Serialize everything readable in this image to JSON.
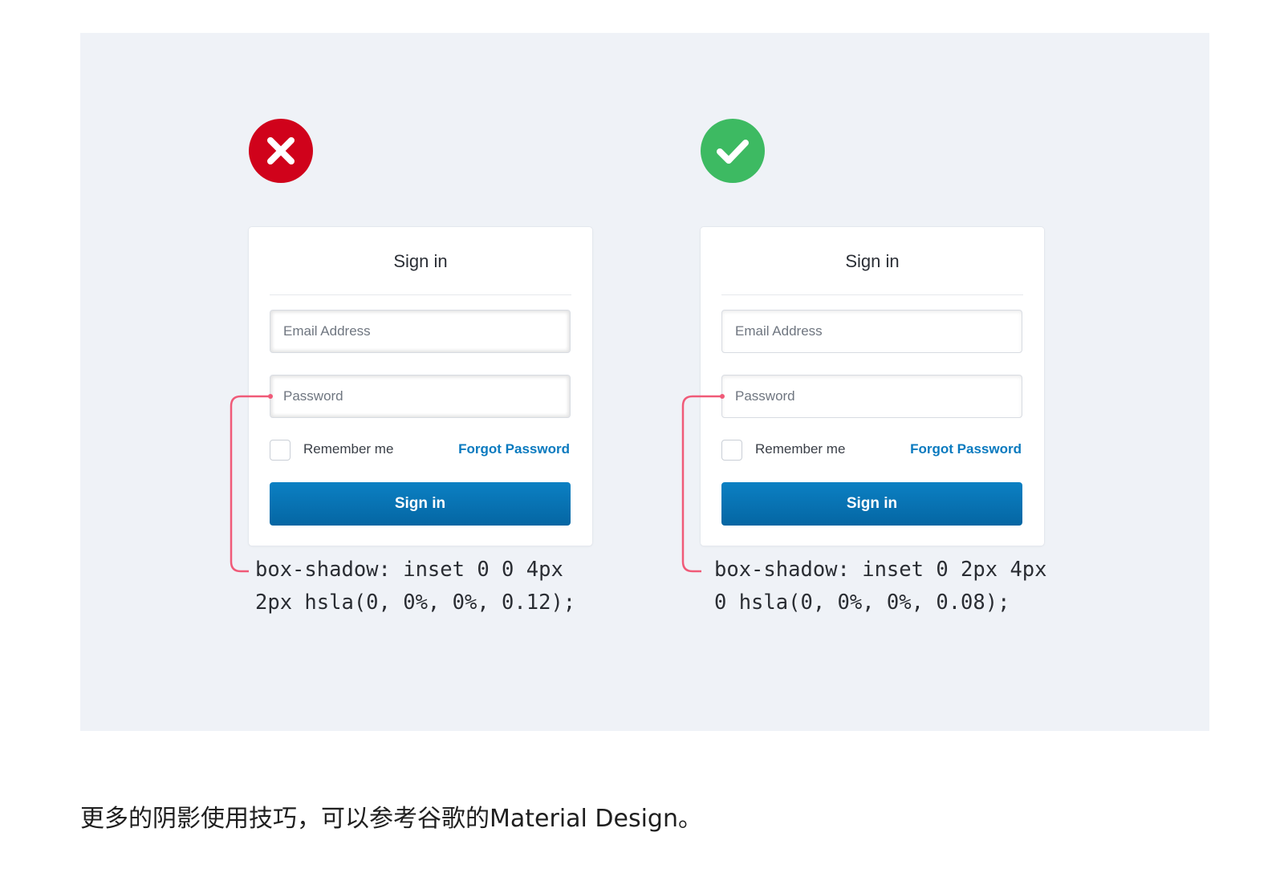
{
  "colors": {
    "panel_bg": "#eff2f7",
    "bad": "#d0021b",
    "good": "#3dba62",
    "primary": "#0a7abf",
    "connector": "#f05a78"
  },
  "bad_example": {
    "badge_icon": "x-icon",
    "card": {
      "title": "Sign in",
      "email_placeholder": "Email Address",
      "password_placeholder": "Password",
      "remember_label": "Remember me",
      "forgot_link": "Forgot Password",
      "signin_button": "Sign in"
    },
    "code_line1": "box-shadow: inset 0 0 4px",
    "code_line2": "2px hsla(0, 0%, 0%, 0.12);"
  },
  "good_example": {
    "badge_icon": "check-icon",
    "card": {
      "title": "Sign in",
      "email_placeholder": "Email Address",
      "password_placeholder": "Password",
      "remember_label": "Remember me",
      "forgot_link": "Forgot Password",
      "signin_button": "Sign in"
    },
    "code_line1": "box-shadow: inset 0 2px 4px",
    "code_line2": "0 hsla(0, 0%, 0%, 0.08);"
  },
  "caption": "更多的阴影使用技巧，可以参考谷歌的Material Design。"
}
